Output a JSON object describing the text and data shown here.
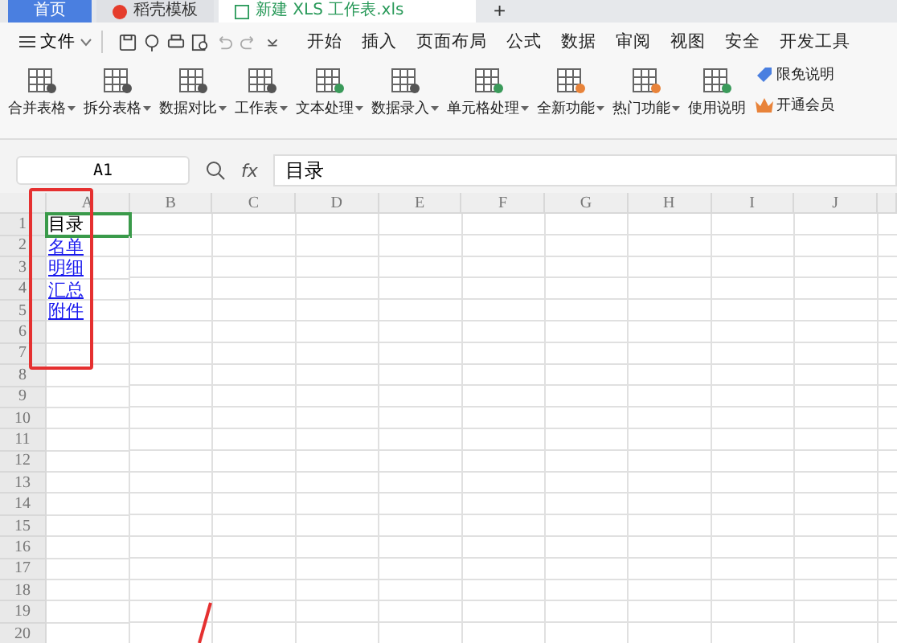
{
  "tabs": [
    {
      "label": "首页",
      "selected": false,
      "kind": "home"
    },
    {
      "label": "稻壳模板",
      "selected": false,
      "kind": "template"
    },
    {
      "label": "新建 XLS 工作表.xls",
      "selected": true,
      "kind": "sheet"
    }
  ],
  "new_tab": "+",
  "menu": {
    "file": "文件",
    "items": [
      "开始",
      "插入",
      "页面布局",
      "公式",
      "数据",
      "审阅",
      "视图",
      "安全",
      "开发工具"
    ]
  },
  "ribbon": [
    {
      "label": "合并表格",
      "dropdown": true
    },
    {
      "label": "拆分表格",
      "dropdown": true
    },
    {
      "label": "数据对比",
      "dropdown": true
    },
    {
      "label": "工作表",
      "dropdown": true
    },
    {
      "label": "文本处理",
      "dropdown": true
    },
    {
      "label": "数据录入",
      "dropdown": true
    },
    {
      "label": "单元格处理",
      "dropdown": true
    },
    {
      "label": "全新功能",
      "dropdown": true
    },
    {
      "label": "热门功能",
      "dropdown": true
    },
    {
      "label": "使用说明",
      "dropdown": false
    }
  ],
  "side_links": [
    "限免说明",
    "开通会员"
  ],
  "formula_bar": {
    "cell_ref": "A1",
    "fx": "fx",
    "value": "目录"
  },
  "columns": [
    "A",
    "B",
    "C",
    "D",
    "E",
    "F",
    "G",
    "H",
    "I",
    "J"
  ],
  "rows": [
    {
      "number": "1",
      "selected": true,
      "cell_a": {
        "text": "目录",
        "kind": "text"
      }
    },
    {
      "number": "2",
      "selected": false,
      "cell_a": {
        "text": "名单",
        "kind": "link"
      }
    },
    {
      "number": "3",
      "selected": false,
      "cell_a": {
        "text": "明细",
        "kind": "link"
      }
    },
    {
      "number": "4",
      "selected": false,
      "cell_a": {
        "text": "汇总",
        "kind": "link"
      }
    },
    {
      "number": "5",
      "selected": false,
      "cell_a": {
        "text": "附件",
        "kind": "link"
      }
    },
    {
      "number": "6",
      "selected": false
    },
    {
      "number": "7",
      "selected": false
    },
    {
      "number": "8",
      "selected": false
    },
    {
      "number": "9",
      "selected": false
    },
    {
      "number": "10",
      "selected": false
    },
    {
      "number": "11",
      "selected": false
    },
    {
      "number": "12",
      "selected": false
    },
    {
      "number": "13",
      "selected": false
    },
    {
      "number": "14",
      "selected": false
    },
    {
      "number": "15",
      "selected": false
    },
    {
      "number": "16",
      "selected": false
    },
    {
      "number": "17",
      "selected": false
    },
    {
      "number": "18",
      "selected": false
    },
    {
      "number": "19",
      "selected": false
    },
    {
      "number": "20",
      "selected": false
    }
  ]
}
